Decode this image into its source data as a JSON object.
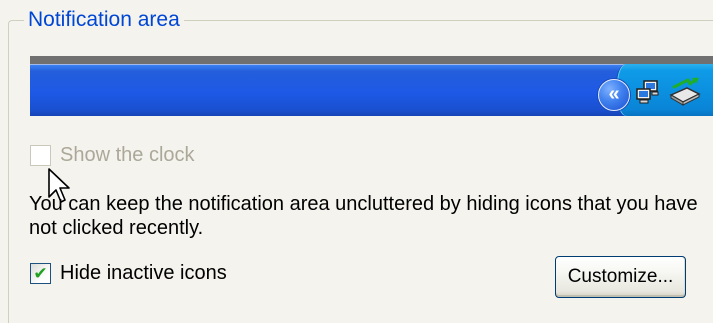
{
  "group": {
    "title": "Notification area"
  },
  "taskbar_preview": {
    "show_hidden_button_glyph": "«",
    "tray_icons": [
      "network-connection-icon",
      "safely-remove-hardware-icon"
    ],
    "colors": {
      "taskbar_blue": "#245edb",
      "tray_blue": "#0f9be8"
    }
  },
  "options": {
    "show_clock": {
      "label": "Show the clock",
      "checked": false,
      "enabled": false
    },
    "info_text": "You can keep the notification area uncluttered by hiding icons that you have not clicked recently.",
    "hide_inactive": {
      "label": "Hide inactive icons",
      "checked": true,
      "enabled": true
    }
  },
  "buttons": {
    "customize_label": "Customize..."
  }
}
